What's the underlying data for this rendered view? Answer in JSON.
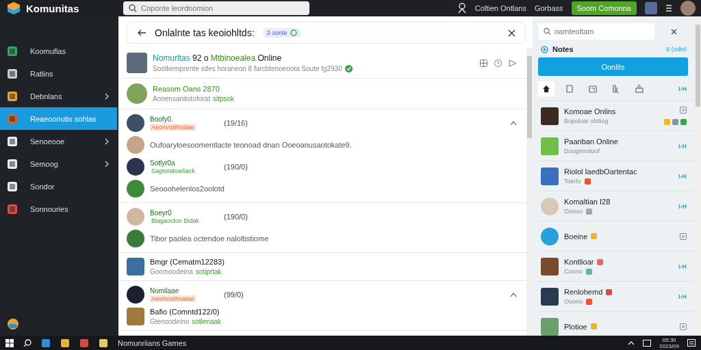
{
  "app": {
    "title": "Komunitas"
  },
  "search": {
    "placeholder": "Coponte leordnomion"
  },
  "top_nav": {
    "links": [
      "Coltien Ontlans",
      "Gorbass"
    ],
    "button": "Soom Comonna"
  },
  "sidebar": {
    "items": [
      {
        "label": "Koomuflas",
        "chevron": false,
        "selected": false
      },
      {
        "label": "Ratlins",
        "chevron": false,
        "selected": false
      },
      {
        "label": "Debnlans",
        "chevron": true,
        "selected": false
      },
      {
        "label": "Reaeoonutis sohlas",
        "chevron": false,
        "selected": true
      },
      {
        "label": "Senoeooe",
        "chevron": true,
        "selected": false
      },
      {
        "label": "Semoog",
        "chevron": true,
        "selected": false
      },
      {
        "label": "Sondor",
        "chevron": false,
        "selected": false
      },
      {
        "label": "Sonnouries",
        "chevron": false,
        "selected": false
      }
    ]
  },
  "center": {
    "title": "Onlalnte tas keoiohltds:",
    "badge": "3 oonte",
    "sections": [
      {
        "items": [
          {
            "kind": "post",
            "title": [
              {
                "text": "Nomurltas",
                "color": "#1b9a8a"
              },
              {
                "text": "92 o",
                "color": "#111111"
              },
              {
                "text": "Mtbinoealea",
                "color": "#3a8a1a"
              },
              {
                "text": "Online",
                "color": "#111111"
              }
            ],
            "subtitle": "Sootkemprente sdes horaneon 8 farcbtenoeoota Soute fg2930",
            "verified": true
          }
        ]
      },
      {
        "items": [
          {
            "kind": "channel",
            "title": "Reasom Oans 2870",
            "subtitle": "Aonensanitotoforat",
            "extra": "sitpsok"
          }
        ]
      },
      {
        "items": [
          {
            "kind": "member",
            "name": "Boofy0.",
            "tag": "Aeonvoshnatae",
            "highlighted": true,
            "count": "(19/16)",
            "collapsible": true
          },
          {
            "kind": "reply",
            "text": "Oufoaryloesoomentlacte teonoad dnan Ooeoanusaotokate9."
          },
          {
            "kind": "member",
            "name": "Sotlyr0a",
            "tag": "Sagtoratioeliack",
            "highlighted": false,
            "count": "(190/0)",
            "collapsible": false
          },
          {
            "kind": "reply",
            "text": "Seooohelenlos2oolotd"
          }
        ]
      },
      {
        "items": [
          {
            "kind": "member",
            "name": "Boeyr0",
            "tag": "Blagaocton Bidak",
            "highlighted": false,
            "count": "(190/0)",
            "collapsible": false
          },
          {
            "kind": "reply",
            "text": "Tibor paolea octendoe naloltistiome"
          }
        ]
      },
      {
        "items": [
          {
            "kind": "game",
            "title": "Bmgr (Cematm12283)",
            "subtitle": "Goomoodeina",
            "extra": "sotiprtak"
          }
        ]
      },
      {
        "items": [
          {
            "kind": "member",
            "name": "Nomilaae",
            "tag": "Aeonvoshnatae",
            "highlighted": true,
            "count": "(99/0)",
            "collapsible": true
          },
          {
            "kind": "game",
            "title": "Bafio (Comntd122/0)",
            "subtitle": "Gtenoodeino",
            "extra": "sotlenaak"
          }
        ]
      }
    ]
  },
  "right_panel": {
    "search": {
      "placeholder": "oamteoltam"
    },
    "notes": {
      "label": "Notes",
      "link": "9 (odtel"
    },
    "button": "Oonlits",
    "tabs_link": "I-H",
    "tabs": [
      {
        "selected": true
      },
      {
        "selected": false
      },
      {
        "selected": false
      },
      {
        "selected": false
      },
      {
        "selected": false
      }
    ],
    "items": [
      {
        "name": "Komoae Onlins",
        "subtitle": "Bopoloar olstiog",
        "corner_badges": [
          {
            "color": "#f0b429"
          },
          {
            "color": "#8a94a6"
          },
          {
            "color": "#3fa34d"
          }
        ]
      },
      {
        "name": "Paanban Online",
        "subtitle": "Doogmrotoof",
        "link": "I-H"
      },
      {
        "name": "Riolol IaedbOartentac",
        "subtitle": "Toerlo",
        "link": "I-H",
        "sub_badges": [
          {
            "color": "#e8572a"
          }
        ]
      },
      {
        "name": "Komaltian I28",
        "subtitle": "Ooooo",
        "link": "I-H",
        "sub_badges": [
          {
            "color": "#a0a7b1"
          }
        ]
      },
      {
        "name": "Boeine",
        "name_badges": [
          {
            "color": "#f0b429"
          }
        ]
      },
      {
        "name": "Kontlioar",
        "subtitle": "Coono",
        "link": "I-H",
        "name_badges": [
          {
            "color": "#e06a6a"
          }
        ],
        "sub_badges": [
          {
            "color": "#5bbf8a"
          }
        ]
      },
      {
        "name": "Renlohemd",
        "subtitle": "Ouono",
        "link": "I-H",
        "name_badges": [
          {
            "color": "#d94c4c"
          }
        ],
        "sub_badges": [
          {
            "color": "#e8572a"
          }
        ]
      },
      {
        "name": "Plotioe",
        "name_badges": [
          {
            "color": "#f0b429"
          }
        ]
      }
    ]
  },
  "taskbar": {
    "app_label": "Nomunriians Games",
    "time": "05:30",
    "date": "2023/09"
  }
}
